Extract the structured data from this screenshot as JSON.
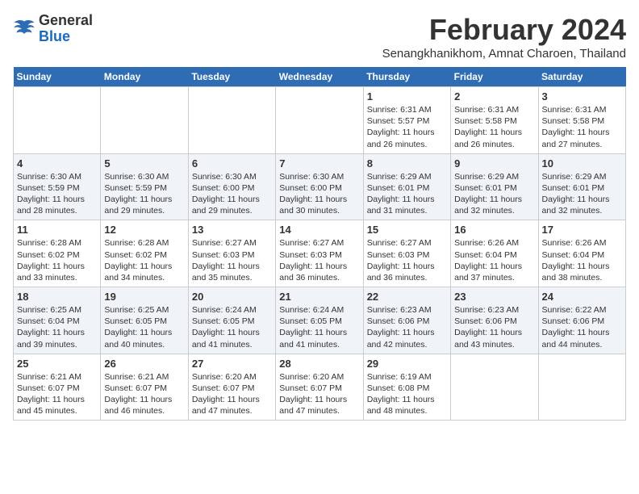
{
  "logo": {
    "general": "General",
    "blue": "Blue"
  },
  "header": {
    "month_year": "February 2024",
    "location": "Senangkhanikhom, Amnat Charoen, Thailand"
  },
  "weekdays": [
    "Sunday",
    "Monday",
    "Tuesday",
    "Wednesday",
    "Thursday",
    "Friday",
    "Saturday"
  ],
  "weeks": [
    [
      {
        "date": "",
        "sunrise": "",
        "sunset": "",
        "daylight": ""
      },
      {
        "date": "",
        "sunrise": "",
        "sunset": "",
        "daylight": ""
      },
      {
        "date": "",
        "sunrise": "",
        "sunset": "",
        "daylight": ""
      },
      {
        "date": "",
        "sunrise": "",
        "sunset": "",
        "daylight": ""
      },
      {
        "date": "1",
        "sunrise": "Sunrise: 6:31 AM",
        "sunset": "Sunset: 5:57 PM",
        "daylight": "Daylight: 11 hours and 26 minutes."
      },
      {
        "date": "2",
        "sunrise": "Sunrise: 6:31 AM",
        "sunset": "Sunset: 5:58 PM",
        "daylight": "Daylight: 11 hours and 26 minutes."
      },
      {
        "date": "3",
        "sunrise": "Sunrise: 6:31 AM",
        "sunset": "Sunset: 5:58 PM",
        "daylight": "Daylight: 11 hours and 27 minutes."
      }
    ],
    [
      {
        "date": "4",
        "sunrise": "Sunrise: 6:30 AM",
        "sunset": "Sunset: 5:59 PM",
        "daylight": "Daylight: 11 hours and 28 minutes."
      },
      {
        "date": "5",
        "sunrise": "Sunrise: 6:30 AM",
        "sunset": "Sunset: 5:59 PM",
        "daylight": "Daylight: 11 hours and 29 minutes."
      },
      {
        "date": "6",
        "sunrise": "Sunrise: 6:30 AM",
        "sunset": "Sunset: 6:00 PM",
        "daylight": "Daylight: 11 hours and 29 minutes."
      },
      {
        "date": "7",
        "sunrise": "Sunrise: 6:30 AM",
        "sunset": "Sunset: 6:00 PM",
        "daylight": "Daylight: 11 hours and 30 minutes."
      },
      {
        "date": "8",
        "sunrise": "Sunrise: 6:29 AM",
        "sunset": "Sunset: 6:01 PM",
        "daylight": "Daylight: 11 hours and 31 minutes."
      },
      {
        "date": "9",
        "sunrise": "Sunrise: 6:29 AM",
        "sunset": "Sunset: 6:01 PM",
        "daylight": "Daylight: 11 hours and 32 minutes."
      },
      {
        "date": "10",
        "sunrise": "Sunrise: 6:29 AM",
        "sunset": "Sunset: 6:01 PM",
        "daylight": "Daylight: 11 hours and 32 minutes."
      }
    ],
    [
      {
        "date": "11",
        "sunrise": "Sunrise: 6:28 AM",
        "sunset": "Sunset: 6:02 PM",
        "daylight": "Daylight: 11 hours and 33 minutes."
      },
      {
        "date": "12",
        "sunrise": "Sunrise: 6:28 AM",
        "sunset": "Sunset: 6:02 PM",
        "daylight": "Daylight: 11 hours and 34 minutes."
      },
      {
        "date": "13",
        "sunrise": "Sunrise: 6:27 AM",
        "sunset": "Sunset: 6:03 PM",
        "daylight": "Daylight: 11 hours and 35 minutes."
      },
      {
        "date": "14",
        "sunrise": "Sunrise: 6:27 AM",
        "sunset": "Sunset: 6:03 PM",
        "daylight": "Daylight: 11 hours and 36 minutes."
      },
      {
        "date": "15",
        "sunrise": "Sunrise: 6:27 AM",
        "sunset": "Sunset: 6:03 PM",
        "daylight": "Daylight: 11 hours and 36 minutes."
      },
      {
        "date": "16",
        "sunrise": "Sunrise: 6:26 AM",
        "sunset": "Sunset: 6:04 PM",
        "daylight": "Daylight: 11 hours and 37 minutes."
      },
      {
        "date": "17",
        "sunrise": "Sunrise: 6:26 AM",
        "sunset": "Sunset: 6:04 PM",
        "daylight": "Daylight: 11 hours and 38 minutes."
      }
    ],
    [
      {
        "date": "18",
        "sunrise": "Sunrise: 6:25 AM",
        "sunset": "Sunset: 6:04 PM",
        "daylight": "Daylight: 11 hours and 39 minutes."
      },
      {
        "date": "19",
        "sunrise": "Sunrise: 6:25 AM",
        "sunset": "Sunset: 6:05 PM",
        "daylight": "Daylight: 11 hours and 40 minutes."
      },
      {
        "date": "20",
        "sunrise": "Sunrise: 6:24 AM",
        "sunset": "Sunset: 6:05 PM",
        "daylight": "Daylight: 11 hours and 41 minutes."
      },
      {
        "date": "21",
        "sunrise": "Sunrise: 6:24 AM",
        "sunset": "Sunset: 6:05 PM",
        "daylight": "Daylight: 11 hours and 41 minutes."
      },
      {
        "date": "22",
        "sunrise": "Sunrise: 6:23 AM",
        "sunset": "Sunset: 6:06 PM",
        "daylight": "Daylight: 11 hours and 42 minutes."
      },
      {
        "date": "23",
        "sunrise": "Sunrise: 6:23 AM",
        "sunset": "Sunset: 6:06 PM",
        "daylight": "Daylight: 11 hours and 43 minutes."
      },
      {
        "date": "24",
        "sunrise": "Sunrise: 6:22 AM",
        "sunset": "Sunset: 6:06 PM",
        "daylight": "Daylight: 11 hours and 44 minutes."
      }
    ],
    [
      {
        "date": "25",
        "sunrise": "Sunrise: 6:21 AM",
        "sunset": "Sunset: 6:07 PM",
        "daylight": "Daylight: 11 hours and 45 minutes."
      },
      {
        "date": "26",
        "sunrise": "Sunrise: 6:21 AM",
        "sunset": "Sunset: 6:07 PM",
        "daylight": "Daylight: 11 hours and 46 minutes."
      },
      {
        "date": "27",
        "sunrise": "Sunrise: 6:20 AM",
        "sunset": "Sunset: 6:07 PM",
        "daylight": "Daylight: 11 hours and 47 minutes."
      },
      {
        "date": "28",
        "sunrise": "Sunrise: 6:20 AM",
        "sunset": "Sunset: 6:07 PM",
        "daylight": "Daylight: 11 hours and 47 minutes."
      },
      {
        "date": "29",
        "sunrise": "Sunrise: 6:19 AM",
        "sunset": "Sunset: 6:08 PM",
        "daylight": "Daylight: 11 hours and 48 minutes."
      },
      {
        "date": "",
        "sunrise": "",
        "sunset": "",
        "daylight": ""
      },
      {
        "date": "",
        "sunrise": "",
        "sunset": "",
        "daylight": ""
      }
    ]
  ]
}
